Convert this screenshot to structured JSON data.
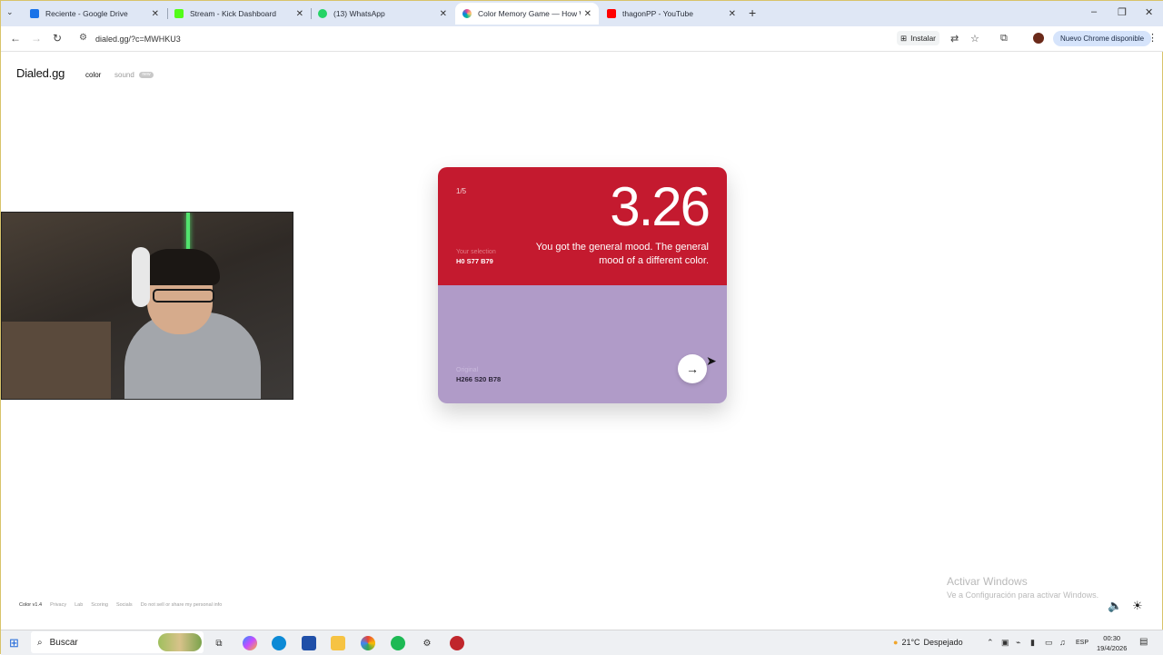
{
  "browser": {
    "tabs": [
      {
        "title": "Reciente - Google Drive",
        "icon": "google-drive-icon",
        "color": "#1a73e8",
        "active": false
      },
      {
        "title": "Stream - Kick Dashboard",
        "icon": "kick-icon",
        "color": "#53fc18",
        "active": false
      },
      {
        "title": "(13) WhatsApp",
        "icon": "whatsapp-icon",
        "color": "#25d366",
        "active": false
      },
      {
        "title": "Color Memory Game — How W",
        "icon": "color-wheel-icon",
        "color": "#e84393",
        "active": true
      },
      {
        "title": "thagonPP - YouTube",
        "icon": "youtube-icon",
        "color": "#ff0000",
        "active": false
      }
    ],
    "tab_close": "✕",
    "new_tab": "+",
    "url": "dialed.gg/?c=MWHKU3",
    "install_label": "Instalar",
    "update_label": "Nuevo Chrome disponible"
  },
  "site": {
    "logo": "Dialed.gg",
    "nav": {
      "color": "color",
      "sound": "sound",
      "sound_badge": "new"
    }
  },
  "game": {
    "progress": "1/5",
    "score": "3.26",
    "feedback": "You got the general mood. The general mood of a different color.",
    "selection_label": "Your selection",
    "selection_value": "H0 S77 B79",
    "original_label": "Original",
    "original_value": "H266 S20 B78",
    "selection_color": "#c41a2f",
    "original_color": "#b09bc8"
  },
  "footer": {
    "items": [
      "Color v1.4",
      "Privacy",
      "Lab",
      "Scoring",
      "Socials",
      "Do not sell or share my personal info"
    ]
  },
  "watermark": {
    "title": "Activar Windows",
    "subtitle": "Ve a Configuración para activar Windows."
  },
  "taskbar": {
    "search_placeholder": "Buscar",
    "weather_temp": "21°C",
    "weather_text": "Despejado",
    "language": "ESP",
    "time": "00:30",
    "date": "19/4/2026"
  }
}
